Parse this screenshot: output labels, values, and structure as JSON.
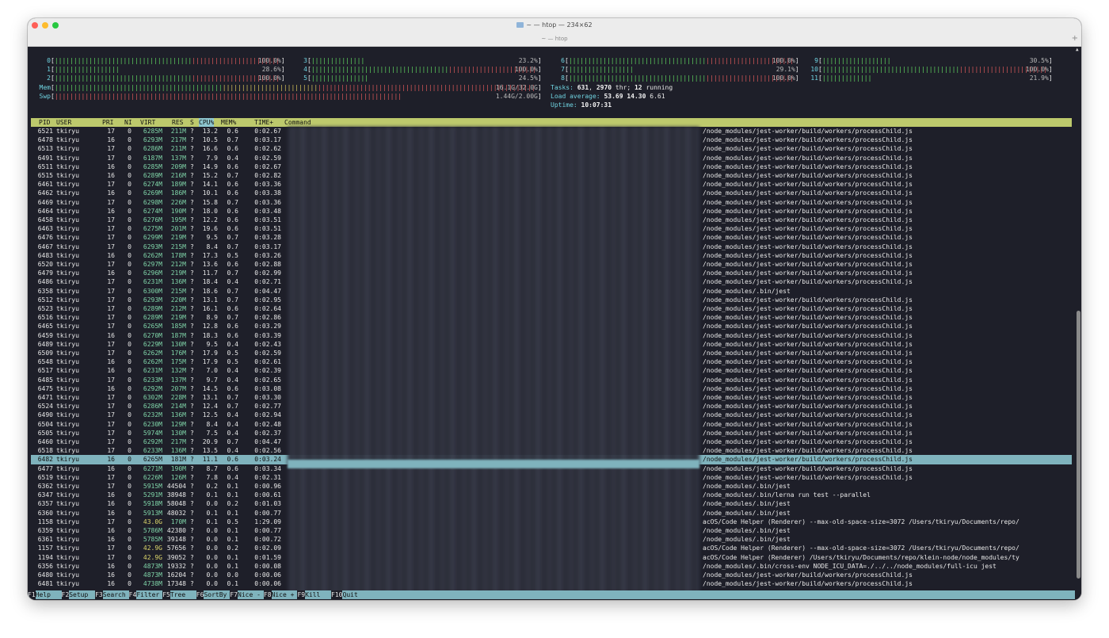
{
  "window": {
    "title": "~ — htop — 234×62",
    "tab_title": "~ — htop",
    "new_tab_symbol": "+"
  },
  "meters": {
    "cpus_left": [
      {
        "label": "0",
        "percent": 100.0,
        "value_text": "100.0%"
      },
      {
        "label": "1",
        "percent": 28.6,
        "value_text": "28.6%"
      },
      {
        "label": "2",
        "percent": 100.0,
        "value_text": "100.0%"
      }
    ],
    "cpus_mid": [
      {
        "label": "3",
        "percent": 23.2,
        "value_text": "23.2%"
      },
      {
        "label": "4",
        "percent": 100.0,
        "value_text": "100.0%"
      },
      {
        "label": "5",
        "percent": 24.5,
        "value_text": "24.5%"
      }
    ],
    "cpus_right1": [
      {
        "label": "6",
        "percent": 100.0,
        "value_text": "100.0%"
      },
      {
        "label": "7",
        "percent": 29.1,
        "value_text": "29.1%"
      },
      {
        "label": "8",
        "percent": 100.0,
        "value_text": "100.0%"
      }
    ],
    "cpus_right2": [
      {
        "label": "9",
        "percent": 30.5,
        "value_text": "30.5%"
      },
      {
        "label": "10",
        "percent": 100.0,
        "value_text": "100.0%"
      },
      {
        "label": "11",
        "percent": 21.9,
        "value_text": "21.9%"
      }
    ],
    "mem": {
      "label": "Mem",
      "fraction": 0.5,
      "value_text": "16.1G/32.0G"
    },
    "swp": {
      "label": "Swp",
      "fraction": 0.72,
      "value_text": "1.44G/2.00G"
    },
    "tasks_label": "Tasks: ",
    "tasks": "631",
    "threads_sep": ", ",
    "threads": "2970",
    "threads_label": " thr; ",
    "running": "12",
    "running_label": " running",
    "load_label": "Load average: ",
    "load1": "53.69",
    "load5": "14.30",
    "load15": "6.61",
    "uptime_label": "Uptime: ",
    "uptime": "10:07:31"
  },
  "columns": {
    "pid": "PID",
    "user": "USER",
    "pri": "PRI",
    "ni": "NI",
    "virt": "VIRT",
    "res": "RES",
    "s": "S",
    "cpu": "CPU%",
    "mem": "MEM%",
    "time": "TIME+",
    "command": "Command"
  },
  "processes": [
    {
      "pid": "6521",
      "user": "tkiryu",
      "pri": "17",
      "ni": "0",
      "virt": "6285M",
      "res": "211M",
      "s": "?",
      "cpu": "13.2",
      "mem": "0.6",
      "time": "0:02.67",
      "cmd": "/node_modules/jest-worker/build/workers/processChild.js"
    },
    {
      "pid": "6478",
      "user": "tkiryu",
      "pri": "16",
      "ni": "0",
      "virt": "6293M",
      "res": "217M",
      "s": "?",
      "cpu": "10.5",
      "mem": "0.7",
      "time": "0:03.17",
      "cmd": "/node_modules/jest-worker/build/workers/processChild.js"
    },
    {
      "pid": "6513",
      "user": "tkiryu",
      "pri": "17",
      "ni": "0",
      "virt": "6286M",
      "res": "211M",
      "s": "?",
      "cpu": "16.6",
      "mem": "0.6",
      "time": "0:02.62",
      "cmd": "/node_modules/jest-worker/build/workers/processChild.js"
    },
    {
      "pid": "6491",
      "user": "tkiryu",
      "pri": "17",
      "ni": "0",
      "virt": "6187M",
      "res": "137M",
      "s": "?",
      "cpu": "7.9",
      "mem": "0.4",
      "time": "0:02.59",
      "cmd": "/node_modules/jest-worker/build/workers/processChild.js"
    },
    {
      "pid": "6511",
      "user": "tkiryu",
      "pri": "16",
      "ni": "0",
      "virt": "6285M",
      "res": "209M",
      "s": "?",
      "cpu": "14.9",
      "mem": "0.6",
      "time": "0:02.67",
      "cmd": "/node_modules/jest-worker/build/workers/processChild.js"
    },
    {
      "pid": "6515",
      "user": "tkiryu",
      "pri": "16",
      "ni": "0",
      "virt": "6289M",
      "res": "216M",
      "s": "?",
      "cpu": "15.2",
      "mem": "0.7",
      "time": "0:02.82",
      "cmd": "/node_modules/jest-worker/build/workers/processChild.js"
    },
    {
      "pid": "6461",
      "user": "tkiryu",
      "pri": "17",
      "ni": "0",
      "virt": "6274M",
      "res": "189M",
      "s": "?",
      "cpu": "14.1",
      "mem": "0.6",
      "time": "0:03.36",
      "cmd": "/node_modules/jest-worker/build/workers/processChild.js"
    },
    {
      "pid": "6462",
      "user": "tkiryu",
      "pri": "16",
      "ni": "0",
      "virt": "6269M",
      "res": "186M",
      "s": "?",
      "cpu": "10.1",
      "mem": "0.6",
      "time": "0:03.38",
      "cmd": "/node_modules/jest-worker/build/workers/processChild.js"
    },
    {
      "pid": "6469",
      "user": "tkiryu",
      "pri": "17",
      "ni": "0",
      "virt": "6298M",
      "res": "226M",
      "s": "?",
      "cpu": "15.8",
      "mem": "0.7",
      "time": "0:03.36",
      "cmd": "/node_modules/jest-worker/build/workers/processChild.js"
    },
    {
      "pid": "6464",
      "user": "tkiryu",
      "pri": "16",
      "ni": "0",
      "virt": "6274M",
      "res": "190M",
      "s": "?",
      "cpu": "18.0",
      "mem": "0.6",
      "time": "0:03.48",
      "cmd": "/node_modules/jest-worker/build/workers/processChild.js"
    },
    {
      "pid": "6458",
      "user": "tkiryu",
      "pri": "17",
      "ni": "0",
      "virt": "6276M",
      "res": "195M",
      "s": "?",
      "cpu": "12.2",
      "mem": "0.6",
      "time": "0:03.51",
      "cmd": "/node_modules/jest-worker/build/workers/processChild.js"
    },
    {
      "pid": "6463",
      "user": "tkiryu",
      "pri": "17",
      "ni": "0",
      "virt": "6275M",
      "res": "201M",
      "s": "?",
      "cpu": "19.6",
      "mem": "0.6",
      "time": "0:03.51",
      "cmd": "/node_modules/jest-worker/build/workers/processChild.js"
    },
    {
      "pid": "6476",
      "user": "tkiryu",
      "pri": "17",
      "ni": "0",
      "virt": "6299M",
      "res": "219M",
      "s": "?",
      "cpu": "9.5",
      "mem": "0.7",
      "time": "0:03.28",
      "cmd": "/node_modules/jest-worker/build/workers/processChild.js"
    },
    {
      "pid": "6467",
      "user": "tkiryu",
      "pri": "17",
      "ni": "0",
      "virt": "6293M",
      "res": "215M",
      "s": "?",
      "cpu": "8.4",
      "mem": "0.7",
      "time": "0:03.17",
      "cmd": "/node_modules/jest-worker/build/workers/processChild.js"
    },
    {
      "pid": "6483",
      "user": "tkiryu",
      "pri": "16",
      "ni": "0",
      "virt": "6262M",
      "res": "178M",
      "s": "?",
      "cpu": "17.3",
      "mem": "0.5",
      "time": "0:03.26",
      "cmd": "/node_modules/jest-worker/build/workers/processChild.js"
    },
    {
      "pid": "6520",
      "user": "tkiryu",
      "pri": "17",
      "ni": "0",
      "virt": "6297M",
      "res": "212M",
      "s": "?",
      "cpu": "13.6",
      "mem": "0.6",
      "time": "0:02.88",
      "cmd": "/node_modules/jest-worker/build/workers/processChild.js"
    },
    {
      "pid": "6479",
      "user": "tkiryu",
      "pri": "16",
      "ni": "0",
      "virt": "6296M",
      "res": "219M",
      "s": "?",
      "cpu": "11.7",
      "mem": "0.7",
      "time": "0:02.99",
      "cmd": "/node_modules/jest-worker/build/workers/processChild.js"
    },
    {
      "pid": "6486",
      "user": "tkiryu",
      "pri": "17",
      "ni": "0",
      "virt": "6231M",
      "res": "136M",
      "s": "?",
      "cpu": "18.4",
      "mem": "0.4",
      "time": "0:02.71",
      "cmd": "/node_modules/jest-worker/build/workers/processChild.js"
    },
    {
      "pid": "6358",
      "user": "tkiryu",
      "pri": "17",
      "ni": "0",
      "virt": "6300M",
      "res": "215M",
      "s": "?",
      "cpu": "18.6",
      "mem": "0.7",
      "time": "0:04.47",
      "cmd": "/node_modules/.bin/jest"
    },
    {
      "pid": "6512",
      "user": "tkiryu",
      "pri": "17",
      "ni": "0",
      "virt": "6293M",
      "res": "220M",
      "s": "?",
      "cpu": "13.1",
      "mem": "0.7",
      "time": "0:02.95",
      "cmd": "/node_modules/jest-worker/build/workers/processChild.js"
    },
    {
      "pid": "6523",
      "user": "tkiryu",
      "pri": "17",
      "ni": "0",
      "virt": "6289M",
      "res": "212M",
      "s": "?",
      "cpu": "16.1",
      "mem": "0.6",
      "time": "0:02.64",
      "cmd": "/node_modules/jest-worker/build/workers/processChild.js"
    },
    {
      "pid": "6516",
      "user": "tkiryu",
      "pri": "17",
      "ni": "0",
      "virt": "6289M",
      "res": "219M",
      "s": "?",
      "cpu": "8.9",
      "mem": "0.7",
      "time": "0:02.86",
      "cmd": "/node_modules/jest-worker/build/workers/processChild.js"
    },
    {
      "pid": "6465",
      "user": "tkiryu",
      "pri": "17",
      "ni": "0",
      "virt": "6265M",
      "res": "185M",
      "s": "?",
      "cpu": "12.8",
      "mem": "0.6",
      "time": "0:03.29",
      "cmd": "/node_modules/jest-worker/build/workers/processChild.js"
    },
    {
      "pid": "6459",
      "user": "tkiryu",
      "pri": "16",
      "ni": "0",
      "virt": "6270M",
      "res": "187M",
      "s": "?",
      "cpu": "18.3",
      "mem": "0.6",
      "time": "0:03.39",
      "cmd": "/node_modules/jest-worker/build/workers/processChild.js"
    },
    {
      "pid": "6489",
      "user": "tkiryu",
      "pri": "17",
      "ni": "0",
      "virt": "6229M",
      "res": "130M",
      "s": "?",
      "cpu": "9.5",
      "mem": "0.4",
      "time": "0:02.43",
      "cmd": "/node_modules/jest-worker/build/workers/processChild.js"
    },
    {
      "pid": "6509",
      "user": "tkiryu",
      "pri": "17",
      "ni": "0",
      "virt": "6262M",
      "res": "176M",
      "s": "?",
      "cpu": "17.9",
      "mem": "0.5",
      "time": "0:02.59",
      "cmd": "/node_modules/jest-worker/build/workers/processChild.js"
    },
    {
      "pid": "6548",
      "user": "tkiryu",
      "pri": "16",
      "ni": "0",
      "virt": "6262M",
      "res": "175M",
      "s": "?",
      "cpu": "17.9",
      "mem": "0.5",
      "time": "0:02.61",
      "cmd": "/node_modules/jest-worker/build/workers/processChild.js"
    },
    {
      "pid": "6517",
      "user": "tkiryu",
      "pri": "16",
      "ni": "0",
      "virt": "6231M",
      "res": "132M",
      "s": "?",
      "cpu": "7.0",
      "mem": "0.4",
      "time": "0:02.39",
      "cmd": "/node_modules/jest-worker/build/workers/processChild.js"
    },
    {
      "pid": "6485",
      "user": "tkiryu",
      "pri": "17",
      "ni": "0",
      "virt": "6233M",
      "res": "137M",
      "s": "?",
      "cpu": "9.7",
      "mem": "0.4",
      "time": "0:02.65",
      "cmd": "/node_modules/jest-worker/build/workers/processChild.js"
    },
    {
      "pid": "6475",
      "user": "tkiryu",
      "pri": "16",
      "ni": "0",
      "virt": "6292M",
      "res": "207M",
      "s": "?",
      "cpu": "14.5",
      "mem": "0.6",
      "time": "0:03.08",
      "cmd": "/node_modules/jest-worker/build/workers/processChild.js"
    },
    {
      "pid": "6471",
      "user": "tkiryu",
      "pri": "17",
      "ni": "0",
      "virt": "6302M",
      "res": "228M",
      "s": "?",
      "cpu": "13.1",
      "mem": "0.7",
      "time": "0:03.30",
      "cmd": "/node_modules/jest-worker/build/workers/processChild.js"
    },
    {
      "pid": "6524",
      "user": "tkiryu",
      "pri": "17",
      "ni": "0",
      "virt": "6286M",
      "res": "214M",
      "s": "?",
      "cpu": "12.4",
      "mem": "0.7",
      "time": "0:02.77",
      "cmd": "/node_modules/jest-worker/build/workers/processChild.js"
    },
    {
      "pid": "6490",
      "user": "tkiryu",
      "pri": "17",
      "ni": "0",
      "virt": "6232M",
      "res": "136M",
      "s": "?",
      "cpu": "12.5",
      "mem": "0.4",
      "time": "0:02.94",
      "cmd": "/node_modules/jest-worker/build/workers/processChild.js"
    },
    {
      "pid": "6504",
      "user": "tkiryu",
      "pri": "17",
      "ni": "0",
      "virt": "6230M",
      "res": "129M",
      "s": "?",
      "cpu": "8.4",
      "mem": "0.4",
      "time": "0:02.48",
      "cmd": "/node_modules/jest-worker/build/workers/processChild.js"
    },
    {
      "pid": "6505",
      "user": "tkiryu",
      "pri": "17",
      "ni": "0",
      "virt": "5974M",
      "res": "130M",
      "s": "?",
      "cpu": "7.5",
      "mem": "0.4",
      "time": "0:02.37",
      "cmd": "/node_modules/jest-worker/build/workers/processChild.js"
    },
    {
      "pid": "6460",
      "user": "tkiryu",
      "pri": "17",
      "ni": "0",
      "virt": "6292M",
      "res": "217M",
      "s": "?",
      "cpu": "20.9",
      "mem": "0.7",
      "time": "0:04.47",
      "cmd": "/node_modules/jest-worker/build/workers/processChild.js"
    },
    {
      "pid": "6518",
      "user": "tkiryu",
      "pri": "17",
      "ni": "0",
      "virt": "6233M",
      "res": "136M",
      "s": "?",
      "cpu": "13.5",
      "mem": "0.4",
      "time": "0:02.56",
      "cmd": "/node_modules/jest-worker/build/workers/processChild.js"
    },
    {
      "pid": "6482",
      "user": "tkiryu",
      "pri": "16",
      "ni": "0",
      "virt": "6265M",
      "res": "181M",
      "s": "?",
      "cpu": "11.1",
      "mem": "0.6",
      "time": "0:03.24",
      "cmd": "/node_modules/jest-worker/build/workers/processChild.js",
      "selected": true
    },
    {
      "pid": "6477",
      "user": "tkiryu",
      "pri": "16",
      "ni": "0",
      "virt": "6271M",
      "res": "190M",
      "s": "?",
      "cpu": "8.7",
      "mem": "0.6",
      "time": "0:03.34",
      "cmd": "/node_modules/jest-worker/build/workers/processChild.js"
    },
    {
      "pid": "6519",
      "user": "tkiryu",
      "pri": "17",
      "ni": "0",
      "virt": "6226M",
      "res": "126M",
      "s": "?",
      "cpu": "7.8",
      "mem": "0.4",
      "time": "0:02.31",
      "cmd": "/node_modules/jest-worker/build/workers/processChild.js"
    },
    {
      "pid": "6362",
      "user": "tkiryu",
      "pri": "17",
      "ni": "0",
      "virt": "5915M",
      "res": "44504",
      "s": "?",
      "cpu": "0.2",
      "mem": "0.1",
      "time": "0:00.96",
      "cmd": "/node_modules/.bin/jest"
    },
    {
      "pid": "6347",
      "user": "tkiryu",
      "pri": "16",
      "ni": "0",
      "virt": "5291M",
      "res": "38948",
      "s": "?",
      "cpu": "0.1",
      "mem": "0.1",
      "time": "0:00.61",
      "cmd": "/node_modules/.bin/lerna run test --parallel"
    },
    {
      "pid": "6357",
      "user": "tkiryu",
      "pri": "16",
      "ni": "0",
      "virt": "5918M",
      "res": "58048",
      "s": "?",
      "cpu": "0.0",
      "mem": "0.2",
      "time": "0:01.03",
      "cmd": "/node_modules/.bin/jest"
    },
    {
      "pid": "6360",
      "user": "tkiryu",
      "pri": "16",
      "ni": "0",
      "virt": "5913M",
      "res": "48032",
      "s": "?",
      "cpu": "0.1",
      "mem": "0.1",
      "time": "0:00.77",
      "cmd": "/node_modules/.bin/jest"
    },
    {
      "pid": "1158",
      "user": "tkiryu",
      "pri": "17",
      "ni": "0",
      "virt": "43.0G",
      "res": "170M",
      "s": "?",
      "cpu": "0.1",
      "mem": "0.5",
      "time": "1:29.09",
      "cmd": "acOS/Code Helper (Renderer) --max-old-space-size=3072 /Users/tkiryu/Documents/repo/"
    },
    {
      "pid": "6359",
      "user": "tkiryu",
      "pri": "16",
      "ni": "0",
      "virt": "5786M",
      "res": "42380",
      "s": "?",
      "cpu": "0.0",
      "mem": "0.1",
      "time": "0:00.77",
      "cmd": "/node_modules/.bin/jest"
    },
    {
      "pid": "6361",
      "user": "tkiryu",
      "pri": "16",
      "ni": "0",
      "virt": "5785M",
      "res": "39148",
      "s": "?",
      "cpu": "0.0",
      "mem": "0.1",
      "time": "0:00.72",
      "cmd": "/node_modules/.bin/jest"
    },
    {
      "pid": "1157",
      "user": "tkiryu",
      "pri": "17",
      "ni": "0",
      "virt": "42.9G",
      "res": "57656",
      "s": "?",
      "cpu": "0.0",
      "mem": "0.2",
      "time": "0:02.09",
      "cmd": "acOS/Code Helper (Renderer) --max-old-space-size=3072 /Users/tkiryu/Documents/repo/"
    },
    {
      "pid": "1194",
      "user": "tkiryu",
      "pri": "17",
      "ni": "0",
      "virt": "42.9G",
      "res": "39052",
      "s": "?",
      "cpu": "0.0",
      "mem": "0.1",
      "time": "0:01.59",
      "cmd": "acOS/Code Helper (Renderer) /Users/tkiryu/Documents/repo/klein-node/node_modules/ty"
    },
    {
      "pid": "6356",
      "user": "tkiryu",
      "pri": "16",
      "ni": "0",
      "virt": "4873M",
      "res": "19332",
      "s": "?",
      "cpu": "0.0",
      "mem": "0.1",
      "time": "0:00.08",
      "cmd": "/node_modules/.bin/cross-env NODE_ICU_DATA=./../../node_modules/full-icu jest"
    },
    {
      "pid": "6480",
      "user": "tkiryu",
      "pri": "16",
      "ni": "0",
      "virt": "4873M",
      "res": "16204",
      "s": "?",
      "cpu": "0.0",
      "mem": "0.0",
      "time": "0:00.06",
      "cmd": "/node_modules/jest-worker/build/workers/processChild.js"
    },
    {
      "pid": "6481",
      "user": "tkiryu",
      "pri": "16",
      "ni": "0",
      "virt": "4738M",
      "res": "17348",
      "s": "?",
      "cpu": "0.0",
      "mem": "0.1",
      "time": "0:00.06",
      "cmd": "/node_modules/jest-worker/build/workers/processChild.js"
    }
  ],
  "footer": [
    {
      "key": "F1",
      "label": "Help"
    },
    {
      "key": "F2",
      "label": "Setup"
    },
    {
      "key": "F3",
      "label": "Search"
    },
    {
      "key": "F4",
      "label": "Filter"
    },
    {
      "key": "F5",
      "label": "Tree"
    },
    {
      "key": "F6",
      "label": "SortBy"
    },
    {
      "key": "F7",
      "label": "Nice -"
    },
    {
      "key": "F8",
      "label": "Nice +"
    },
    {
      "key": "F9",
      "label": "Kill"
    },
    {
      "key": "F10",
      "label": "Quit"
    }
  ],
  "colors": {
    "terminal_bg": "#1e1f29",
    "header_bg": "#bdc96c",
    "selection_bg": "#7fb3bd",
    "bar_green": "#5fd35f",
    "bar_red": "#e05a5a",
    "bar_yellow": "#d8c45a",
    "label_cyan": "#6fd3e0"
  }
}
